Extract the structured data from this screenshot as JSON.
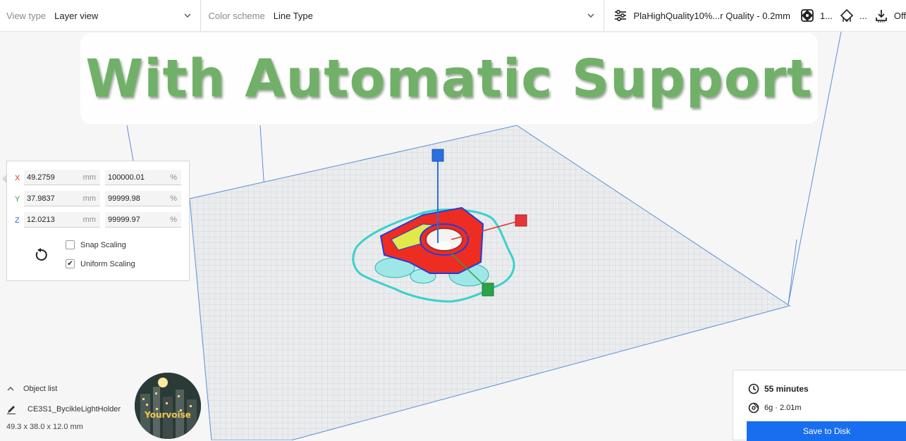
{
  "toolbar": {
    "view_type_label": "View type",
    "view_type_value": "Layer view",
    "color_scheme_label": "Color scheme",
    "color_scheme_value": "Line Type",
    "profile": "PlaHighQuality10%...r Quality - 0.2mm",
    "support_value": "1...",
    "adhesion_value": "...",
    "adhesion_state": "Off"
  },
  "banner": {
    "text": "With Automatic Support",
    "color": "#6cae63"
  },
  "scale_panel": {
    "x": {
      "axis": "X",
      "mm": "49.2759",
      "mm_unit": "mm",
      "percent": "100000.01",
      "pct_unit": "%",
      "color": "#e0352b"
    },
    "y": {
      "axis": "Y",
      "mm": "37.9837",
      "mm_unit": "mm",
      "percent": "99999.98",
      "pct_unit": "%",
      "color": "#2fa044"
    },
    "z": {
      "axis": "Z",
      "mm": "12.0213",
      "mm_unit": "mm",
      "percent": "99999.97",
      "pct_unit": "%",
      "color": "#2a6fde"
    },
    "snap_scaling": "Snap Scaling",
    "uniform_scaling": "Uniform Scaling",
    "snap_checked": false,
    "uniform_checked": true
  },
  "object_list": {
    "header": "Object list",
    "object_name": "CE3S1_BycikleLightHolder",
    "dimensions": "49.3 x 38.0 x 12.0 mm"
  },
  "avatar": {
    "label": "Yourvoise"
  },
  "print_info": {
    "time": "55 minutes",
    "material": "6g · 2.01m",
    "save_button": "Save to Disk",
    "accent": "#196ef0"
  }
}
